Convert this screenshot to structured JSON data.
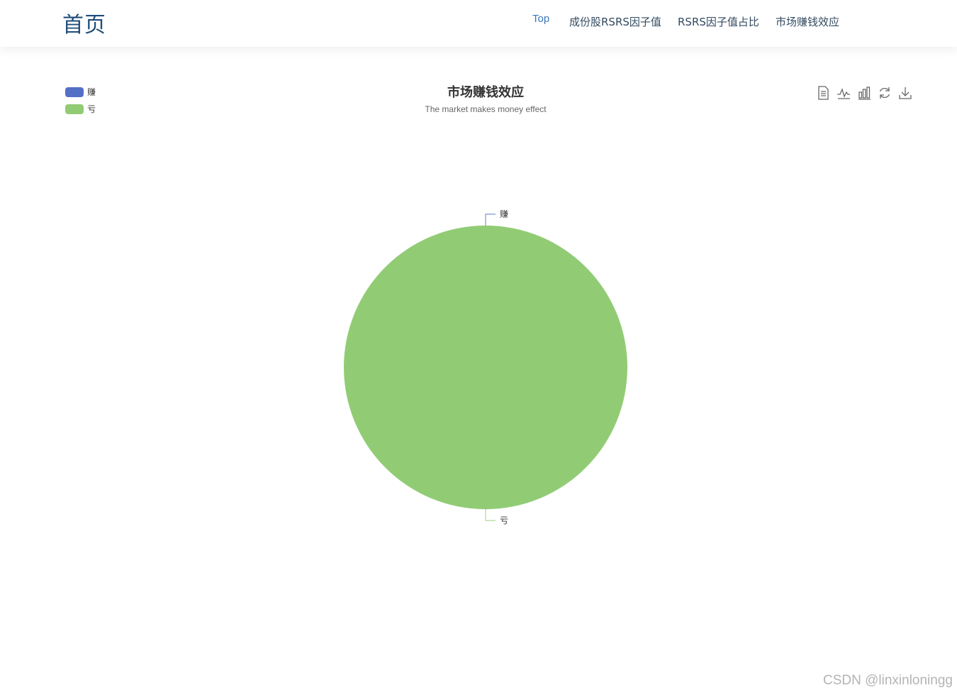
{
  "nav": {
    "brand": "首页",
    "items": [
      {
        "label": "Top"
      },
      {
        "label": "成份股RSRS因子值"
      },
      {
        "label": "RSRS因子值占比"
      },
      {
        "label": "市场赚钱效应"
      }
    ]
  },
  "toolbox": {
    "icons": [
      "data-view-icon",
      "line-chart-icon",
      "bar-chart-icon",
      "restore-icon",
      "download-icon"
    ]
  },
  "colors": {
    "series": [
      "#5470c6",
      "#91cc75"
    ],
    "brand": "#1f4e79",
    "nav_active": "#3a78b8"
  },
  "chart_data": {
    "type": "pie",
    "title": "市场赚钱效应",
    "subtitle": "The market makes money effect",
    "legend_position": "top-left",
    "categories": [
      "赚",
      "亏"
    ],
    "values": [
      0,
      1
    ],
    "series": [
      {
        "label": "赚",
        "value": 0,
        "color": "#5470c6"
      },
      {
        "label": "亏",
        "value": 1,
        "color": "#91cc75"
      }
    ]
  },
  "watermark": "CSDN @linxinloningg"
}
